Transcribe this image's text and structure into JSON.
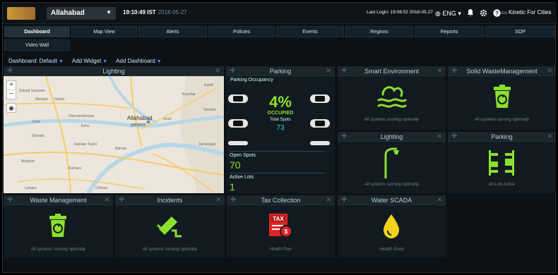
{
  "header": {
    "city": "Allahabad",
    "time": "19:10:49 IST",
    "date": "2018-05-27",
    "last_login": "Last Login: 19:08:02 2018-05-27",
    "language": "ENG",
    "brand": "Kinetic For Cities"
  },
  "nav": {
    "tabs": [
      "Dashboard",
      "Map View",
      "Alerts",
      "Policies",
      "Events",
      "Regions",
      "Reports",
      "SOP",
      "Video Wall"
    ],
    "active": "Dashboard"
  },
  "toolbar": {
    "dashboard_label": "Dashboard: Default",
    "add_widget": "Add Widget",
    "add_dashboard": "Add Dashboard"
  },
  "widgets": {
    "lighting": {
      "title": "Lighting"
    },
    "parking": {
      "title": "Parking",
      "occupancy_label": "Parking Occupancy",
      "percent": "4%",
      "occupied_label": "OCCUPIED",
      "total_label": "Total Spots",
      "total_value": "73",
      "open_label": "Open Spots",
      "open_value": "70",
      "active_label": "Active Lots",
      "active_value": "1"
    },
    "smart_environment": {
      "title": "Smart Environment",
      "status": "All systems running optimally"
    },
    "solid_waste": {
      "title": "Solid WasteManagement",
      "status": "All systems running optimally"
    },
    "lighting_small": {
      "title": "Lighting",
      "status": "All systems running optimally"
    },
    "parking_small": {
      "title": "Parking",
      "status": "All Lots Active"
    },
    "waste_management": {
      "title": "Waste Management",
      "status": "All systems running optimally"
    },
    "incidents": {
      "title": "Incidents",
      "status": "All systems running optimally"
    },
    "tax_collection": {
      "title": "Tax Collection",
      "status": "Health Poor",
      "icon_text": "TAX"
    },
    "water_scada": {
      "title": "Water SCADA",
      "status": "Health Good"
    }
  },
  "map_labels": {
    "city": "Allahabad",
    "city_hindi": "इलाहाबाद",
    "places": [
      "Saiyad Sarawan",
      "Manauri",
      "Hatwa",
      "Chail",
      "Sironda",
      "Chandrathanpur",
      "Bahu",
      "Jhusi",
      "Tandwa",
      "Aairawn Kalan",
      "Bairnar",
      "Kaurihar",
      "Jamunapur",
      "Kandi",
      "Karhara",
      "Lalapur",
      "Chitauri",
      "Aurghan"
    ],
    "zoom_in": "+",
    "zoom_out": "−"
  },
  "colors": {
    "accent_green": "#8be02d",
    "accent_blue": "#35c1e8",
    "tax_red": "#e02424",
    "water_yellow": "#f2d21b"
  }
}
